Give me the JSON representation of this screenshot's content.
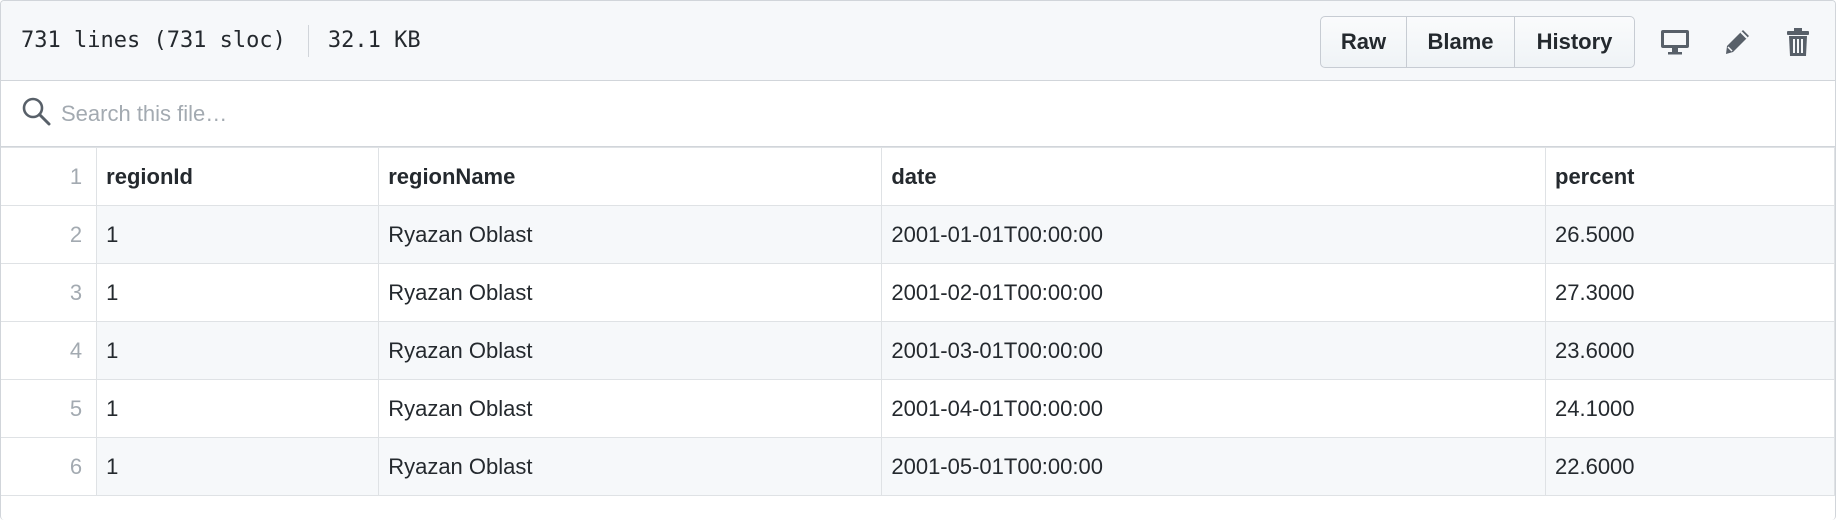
{
  "file_header": {
    "lines_info": "731 lines (731 sloc)",
    "size": "32.1 KB",
    "buttons": {
      "raw": "Raw",
      "blame": "Blame",
      "history": "History"
    },
    "icons": [
      "desktop-icon",
      "pencil-icon",
      "trashcan-icon"
    ]
  },
  "search": {
    "placeholder": "Search this file…",
    "value": ""
  },
  "table": {
    "headers": [
      "regionId",
      "regionName",
      "date",
      "percent"
    ],
    "rows": [
      {
        "line": "1",
        "cells": [
          "regionId",
          "regionName",
          "date",
          "percent"
        ]
      },
      {
        "line": "2",
        "cells": [
          "1",
          "Ryazan Oblast",
          "2001-01-01T00:00:00",
          "26.5000"
        ]
      },
      {
        "line": "3",
        "cells": [
          "1",
          "Ryazan Oblast",
          "2001-02-01T00:00:00",
          "27.3000"
        ]
      },
      {
        "line": "4",
        "cells": [
          "1",
          "Ryazan Oblast",
          "2001-03-01T00:00:00",
          "23.6000"
        ]
      },
      {
        "line": "5",
        "cells": [
          "1",
          "Ryazan Oblast",
          "2001-04-01T00:00:00",
          "24.1000"
        ]
      },
      {
        "line": "6",
        "cells": [
          "1",
          "Ryazan Oblast",
          "2001-05-01T00:00:00",
          "22.6000"
        ]
      }
    ]
  },
  "colors": {
    "border": "#d1d5da",
    "header_bg": "#f6f8fa",
    "icon": "#586069",
    "line_number": "#a3aab1"
  }
}
